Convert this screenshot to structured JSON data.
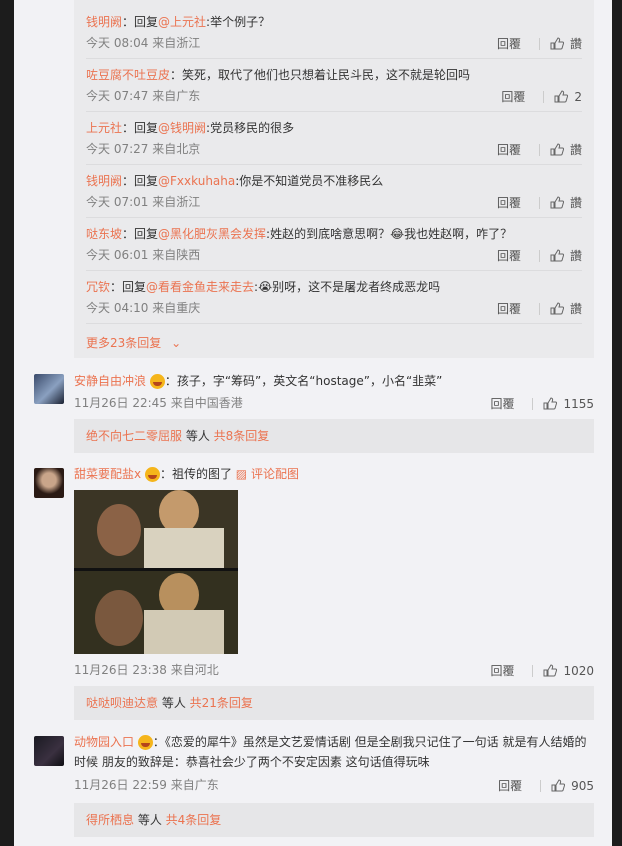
{
  "sub_replies": [
    {
      "user": "钱明阙",
      "reply_word": "：回复",
      "at": "@上元社",
      "text": ":举个例子？",
      "time": "今天 08:04 来自浙江",
      "reply_label": "回覆",
      "likes": "讚"
    },
    {
      "user": "咗豆腐不吐豆皮",
      "reply_word": "",
      "at": "",
      "text": "：笑死，取代了他们也只想着让民斗民，这不就是轮回吗",
      "time": "今天 07:47 来自广东",
      "reply_label": "回覆",
      "likes": "2"
    },
    {
      "user": "上元社",
      "reply_word": "：回复",
      "at": "@钱明阙",
      "text": ":党员移民的很多",
      "time": "今天 07:27 来自北京",
      "reply_label": "回覆",
      "likes": "讚"
    },
    {
      "user": "钱明阙",
      "reply_word": "：回复",
      "at": "@Fxxkuhaha",
      "text": ":你是不知道党员不准移民么",
      "time": "今天 07:01 来自浙江",
      "reply_label": "回覆",
      "likes": "讚"
    },
    {
      "user": "哒东坡",
      "reply_word": "：回复",
      "at": "@黑化肥灰黑会发挥",
      "text": ":姓赵的到底啥意思啊？😂我也姓赵啊，咋了？",
      "time": "今天 06:01 来自陕西",
      "reply_label": "回覆",
      "likes": "讚"
    },
    {
      "user": "冗钦",
      "reply_word": "：回复",
      "at": "@看看金鱼走来走去",
      "text": ":😭别呀，这不是屠龙者终成恶龙吗",
      "time": "今天 04:10 来自重庆",
      "reply_label": "回覆",
      "likes": "讚"
    }
  ],
  "more_replies": "更多23条回复",
  "comments": [
    {
      "user": "安静自由冲浪",
      "text": "：孩子，字“筹码”，英文名“hostage”，小名“韭菜”",
      "time": "11月26日 22:45 来自中国香港",
      "reply_label": "回覆",
      "likes": "1155",
      "sub_user": "绝不向七二零屈服",
      "sub_mid": " 等人 ",
      "sub_count": "共8条回复"
    },
    {
      "user": "甜菜要配盐x",
      "text": "：祖传的图了",
      "pic_label": "评论配图",
      "time": "11月26日 23:38 来自河北",
      "reply_label": "回覆",
      "likes": "1020",
      "sub_user": "哒哒呗迪达意",
      "sub_mid": " 等人 ",
      "sub_count": "共21条回复"
    },
    {
      "user": "动物园入口",
      "text": "：《恋爱的犀牛》虽然是文艺爱情话剧 但是全剧我只记住了一句话 就是有人结婚的",
      "text2": "时候 朋友的致辞是：恭喜社会少了两个不安定因素 这句话值得玩味",
      "time": "11月26日 22:59 来自广东",
      "reply_label": "回覆",
      "likes": "905",
      "sub_user": "得所栖息",
      "sub_mid": " 等人 ",
      "sub_count": "共4条回复"
    }
  ],
  "colors": {
    "link": "#eb7350",
    "meta": "#808080"
  }
}
